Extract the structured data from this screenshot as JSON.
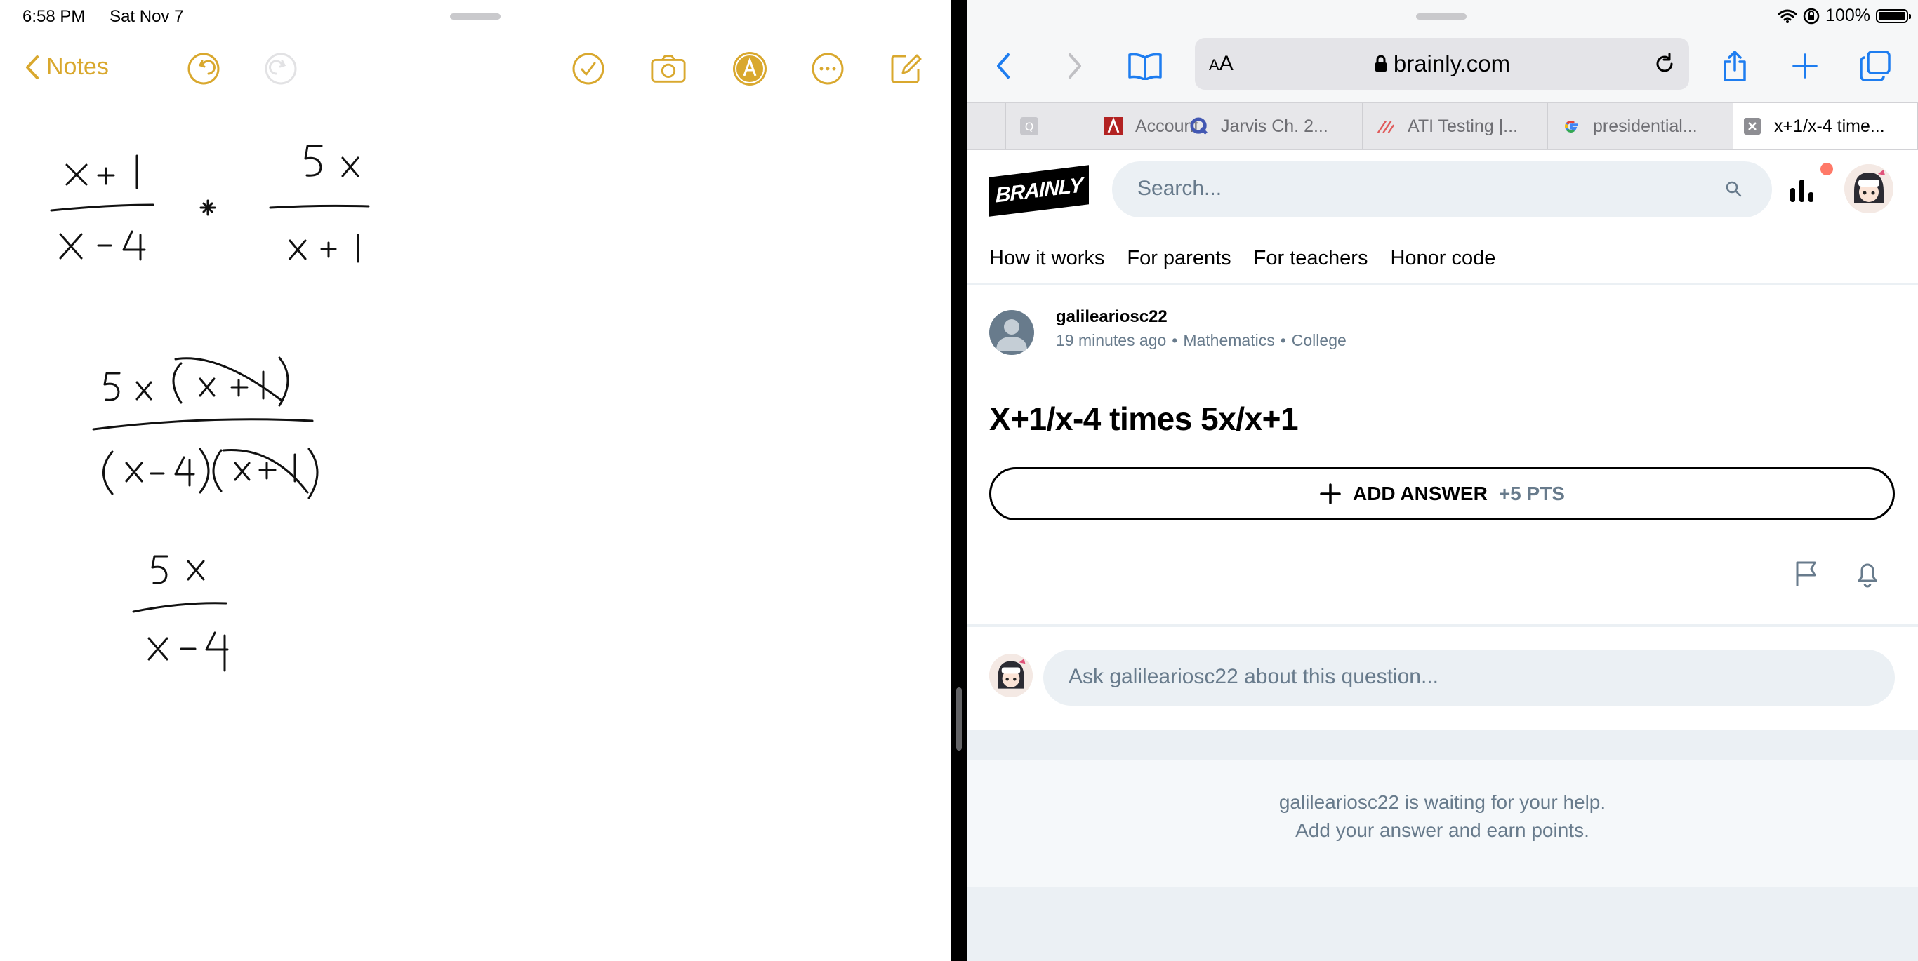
{
  "status": {
    "time": "6:58 PM",
    "date": "Sat Nov 7",
    "battery": "100%"
  },
  "notes": {
    "back_label": "Notes",
    "toolbar_icons": [
      "undo-icon",
      "redo-icon",
      "checklist-icon",
      "camera-icon",
      "markup-icon",
      "more-icon",
      "compose-icon"
    ],
    "accent": "#d9a82e"
  },
  "safari": {
    "url_text_size_label": "AA",
    "url": "brainly.com",
    "tabs": [
      {
        "label": "",
        "icon": "blank-tab-icon"
      },
      {
        "label": "Account",
        "icon": "account-favicon"
      },
      {
        "label": "Jarvis Ch. 2...",
        "icon": "quizlet-favicon"
      },
      {
        "label": "ATI Testing |...",
        "icon": "ati-favicon"
      },
      {
        "label": "presidential...",
        "icon": "google-favicon"
      },
      {
        "label": "x+1/x-4 time...",
        "icon": "close-tab-icon",
        "active": true
      }
    ]
  },
  "brainly": {
    "logo": "BRAINLY",
    "search_placeholder": "Search...",
    "nav": [
      "How it works",
      "For parents",
      "For teachers",
      "Honor code"
    ],
    "question": {
      "username": "galileariosc22",
      "time_ago": "19 minutes ago",
      "subject": "Mathematics",
      "level": "College",
      "title": "X+1/x-4 times 5x/x+1"
    },
    "add_answer_label": "ADD ANSWER",
    "add_answer_points": "+5 PTS",
    "ask_placeholder": "Ask galileariosc22 about this question...",
    "waiting_line1": "galileariosc22 is waiting for your help.",
    "waiting_line2": "Add your answer and earn points.",
    "accent": "#ff7968",
    "muted": "#687b8c"
  }
}
